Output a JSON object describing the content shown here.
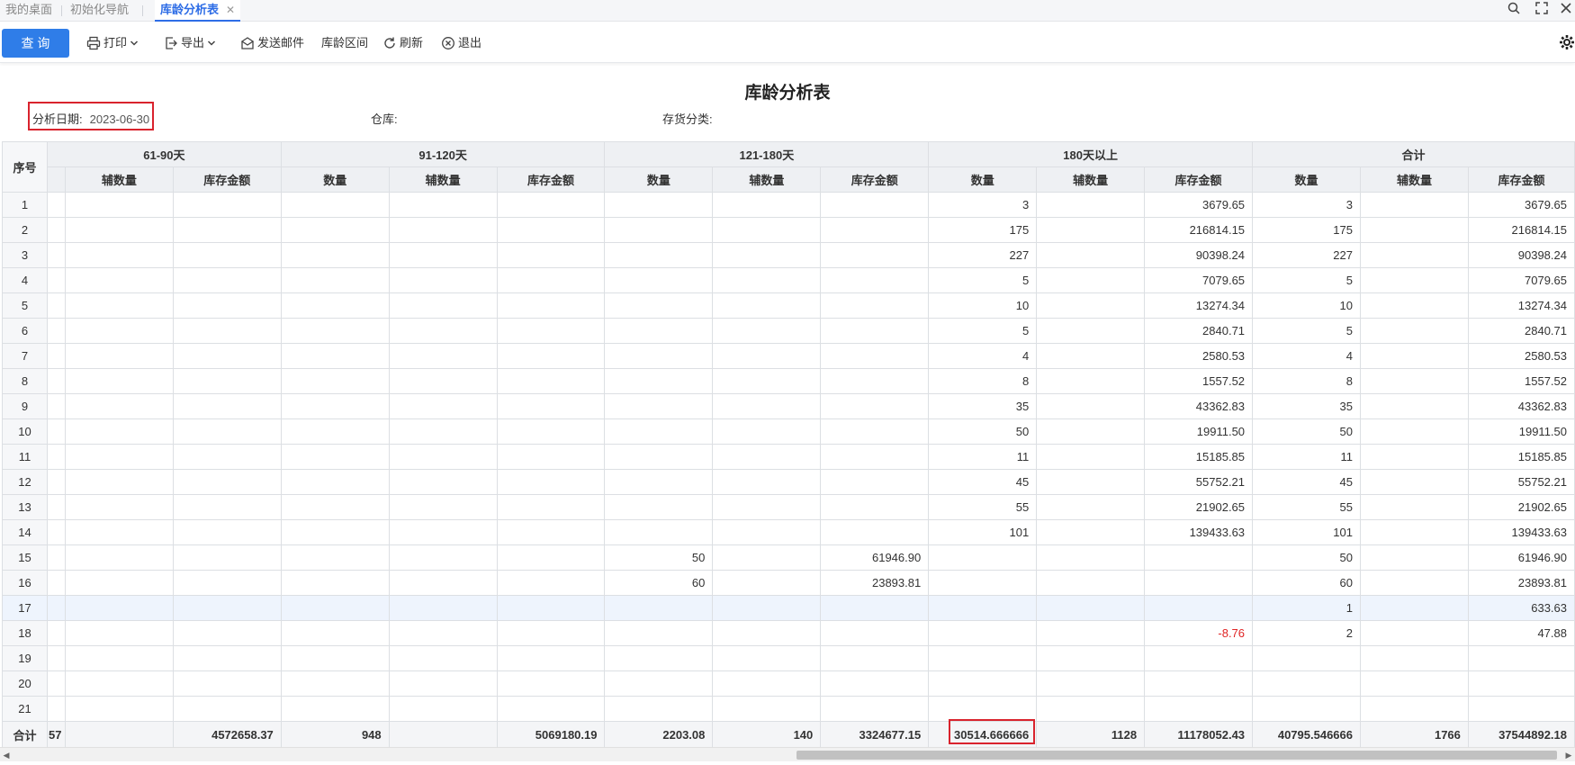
{
  "tabs": [
    {
      "label": "我的桌面"
    },
    {
      "label": "初始化导航"
    },
    {
      "label": "库龄分析表",
      "close": "✕"
    }
  ],
  "toolbar": {
    "query_label": "查 询",
    "print_label": "打印",
    "export_label": "导出",
    "email_label": "发送邮件",
    "range_label": "库龄区间",
    "refresh_label": "刷新",
    "exit_label": "退出"
  },
  "report": {
    "title": "库龄分析表",
    "filters": {
      "date_label": "分析日期:",
      "date_value": "2023-06-30",
      "warehouse_label": "仓库:",
      "category_label": "存货分类:"
    }
  },
  "table": {
    "seq_header": "序号",
    "groups": [
      "61-90天",
      "91-120天",
      "121-180天",
      "180天以上",
      "合计"
    ],
    "sub_headers": [
      "辅数量",
      "库存金额",
      "数量",
      "辅数量",
      "库存金额",
      "数量",
      "辅数量",
      "库存金额",
      "数量",
      "辅数量",
      "库存金额",
      "数量",
      "辅数量",
      "库存金额"
    ],
    "rows": [
      [
        "1",
        "",
        "",
        "",
        "",
        "",
        "",
        "",
        "",
        "3",
        "",
        "3679.65",
        "3",
        "",
        "3679.65"
      ],
      [
        "2",
        "",
        "",
        "",
        "",
        "",
        "",
        "",
        "",
        "175",
        "",
        "216814.15",
        "175",
        "",
        "216814.15"
      ],
      [
        "3",
        "",
        "",
        "",
        "",
        "",
        "",
        "",
        "",
        "227",
        "",
        "90398.24",
        "227",
        "",
        "90398.24"
      ],
      [
        "4",
        "",
        "",
        "",
        "",
        "",
        "",
        "",
        "",
        "5",
        "",
        "7079.65",
        "5",
        "",
        "7079.65"
      ],
      [
        "5",
        "",
        "",
        "",
        "",
        "",
        "",
        "",
        "",
        "10",
        "",
        "13274.34",
        "10",
        "",
        "13274.34"
      ],
      [
        "6",
        "",
        "",
        "",
        "",
        "",
        "",
        "",
        "",
        "5",
        "",
        "2840.71",
        "5",
        "",
        "2840.71"
      ],
      [
        "7",
        "",
        "",
        "",
        "",
        "",
        "",
        "",
        "",
        "4",
        "",
        "2580.53",
        "4",
        "",
        "2580.53"
      ],
      [
        "8",
        "",
        "",
        "",
        "",
        "",
        "",
        "",
        "",
        "8",
        "",
        "1557.52",
        "8",
        "",
        "1557.52"
      ],
      [
        "9",
        "",
        "",
        "",
        "",
        "",
        "",
        "",
        "",
        "35",
        "",
        "43362.83",
        "35",
        "",
        "43362.83"
      ],
      [
        "10",
        "",
        "",
        "",
        "",
        "",
        "",
        "",
        "",
        "50",
        "",
        "19911.50",
        "50",
        "",
        "19911.50"
      ],
      [
        "11",
        "",
        "",
        "",
        "",
        "",
        "",
        "",
        "",
        "11",
        "",
        "15185.85",
        "11",
        "",
        "15185.85"
      ],
      [
        "12",
        "",
        "",
        "",
        "",
        "",
        "",
        "",
        "",
        "45",
        "",
        "55752.21",
        "45",
        "",
        "55752.21"
      ],
      [
        "13",
        "",
        "",
        "",
        "",
        "",
        "",
        "",
        "",
        "55",
        "",
        "21902.65",
        "55",
        "",
        "21902.65"
      ],
      [
        "14",
        "",
        "",
        "",
        "",
        "",
        "",
        "",
        "",
        "101",
        "",
        "139433.63",
        "101",
        "",
        "139433.63"
      ],
      [
        "15",
        "",
        "",
        "",
        "",
        "",
        "50",
        "",
        "61946.90",
        "",
        "",
        "",
        "50",
        "",
        "61946.90"
      ],
      [
        "16",
        "",
        "",
        "",
        "",
        "",
        "60",
        "",
        "23893.81",
        "",
        "",
        "",
        "60",
        "",
        "23893.81"
      ],
      [
        "17",
        "",
        "",
        "",
        "",
        "",
        "",
        "",
        "",
        "",
        "",
        "",
        "1",
        "",
        "633.63"
      ],
      [
        "18",
        "",
        "",
        "",
        "",
        "",
        "",
        "",
        "",
        "",
        "",
        "-8.76",
        "2",
        "",
        "47.88"
      ],
      [
        "19",
        "",
        "",
        "",
        "",
        "",
        "",
        "",
        "",
        "",
        "",
        "",
        "",
        "",
        ""
      ],
      [
        "20",
        "",
        "",
        "",
        "",
        "",
        "",
        "",
        "",
        "",
        "",
        "",
        "",
        "",
        ""
      ],
      [
        "21",
        "",
        "",
        "",
        "",
        "",
        "",
        "",
        "",
        "",
        "",
        "",
        "",
        "",
        ""
      ]
    ],
    "highlight_row": "17",
    "total_row": {
      "label": "合计",
      "partial": "57",
      "cells": [
        "",
        "4572658.37",
        "948",
        "",
        "5069180.19",
        "2203.08",
        "140",
        "3324677.15",
        "30514.666666",
        "1128",
        "11178052.43",
        "40795.546666",
        "1766",
        "37544892.18"
      ]
    }
  },
  "colors": {
    "accent": "#2f7de8",
    "highlight_border": "#d9232d",
    "negative": "#e02525"
  }
}
